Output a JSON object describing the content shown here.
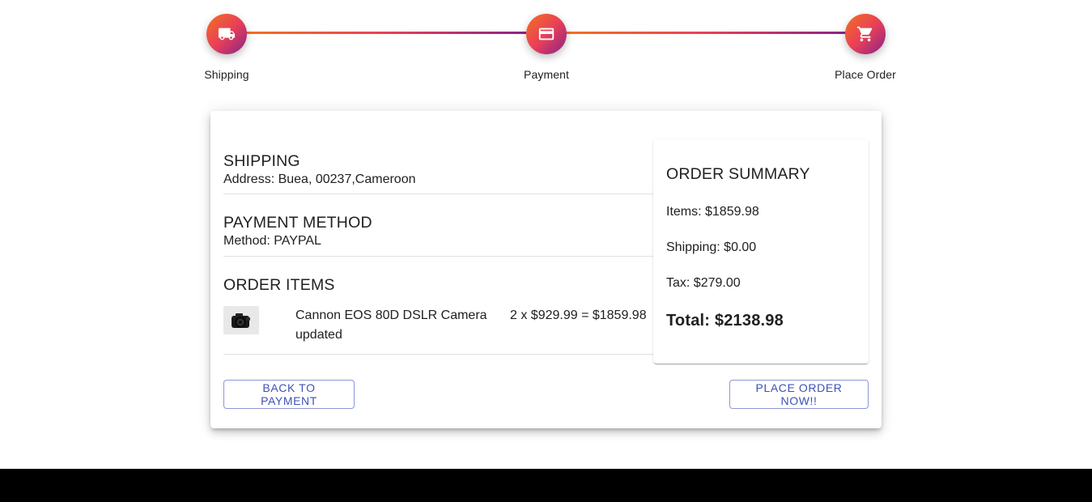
{
  "stepper": {
    "steps": [
      {
        "label": "Shipping",
        "icon": "truck-icon"
      },
      {
        "label": "Payment",
        "icon": "credit-card-icon"
      },
      {
        "label": "Place Order",
        "icon": "cart-icon"
      }
    ],
    "gradient_colors": [
      "#f27121",
      "#e94057",
      "#8a2387"
    ]
  },
  "shipping": {
    "title": "SHIPPING",
    "address": "Address: Buea, 00237,Cameroon"
  },
  "payment": {
    "title": "PAYMENT METHOD",
    "method": "Method: PAYPAL"
  },
  "order_items": {
    "title": "ORDER ITEMS",
    "items": [
      {
        "name": "Cannon EOS 80D DSLR Camera updated",
        "price_line": "2 x $929.99 = $1859.98",
        "thumbnail": "camera-thumbnail"
      }
    ]
  },
  "summary": {
    "title": "ORDER SUMMARY",
    "items": "Items: $1859.98",
    "shipping": "Shipping: $0.00",
    "tax": "Tax: $279.00",
    "total": "Total: $2138.98"
  },
  "actions": {
    "back_label": "BACK TO PAYMENT",
    "place_label": "PLACE ORDER NOW!!",
    "accent_color": "#3f51b5"
  }
}
